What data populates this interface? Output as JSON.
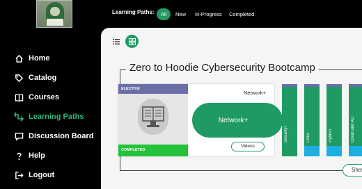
{
  "nav": {
    "items": [
      {
        "label": "Home",
        "icon": "home-icon"
      },
      {
        "label": "Catalog",
        "icon": "tag-icon"
      },
      {
        "label": "Courses",
        "icon": "book-icon"
      },
      {
        "label": "Learning Paths",
        "icon": "path-icon",
        "active": true
      },
      {
        "label": "Discussion Board",
        "icon": "chat-icon"
      },
      {
        "label": "Help",
        "icon": "help-icon"
      },
      {
        "label": "Logout",
        "icon": "logout-icon"
      }
    ]
  },
  "topbar": {
    "label": "Learning Paths:",
    "tabs": [
      "All",
      "New",
      "In-Progress",
      "Completed"
    ],
    "active_tab": "All"
  },
  "main": {
    "path_title": "Zero to Hoodie Cybersecurity Bootcamp",
    "card": {
      "badge_top": "ELECTIVE",
      "badge_bottom": "COMPLETED",
      "label": "Network+",
      "pill": "Network+",
      "button": "Videos"
    },
    "strips": [
      "Security+",
      "Linux",
      "Python",
      "Cloud and AD"
    ],
    "show_button": "Show"
  },
  "colors": {
    "accent": "#1f9a62",
    "active_nav": "#28b77a",
    "elective": "#6b6fa8",
    "completed": "#23c23a",
    "strip_bottom": "#1eaee2"
  }
}
